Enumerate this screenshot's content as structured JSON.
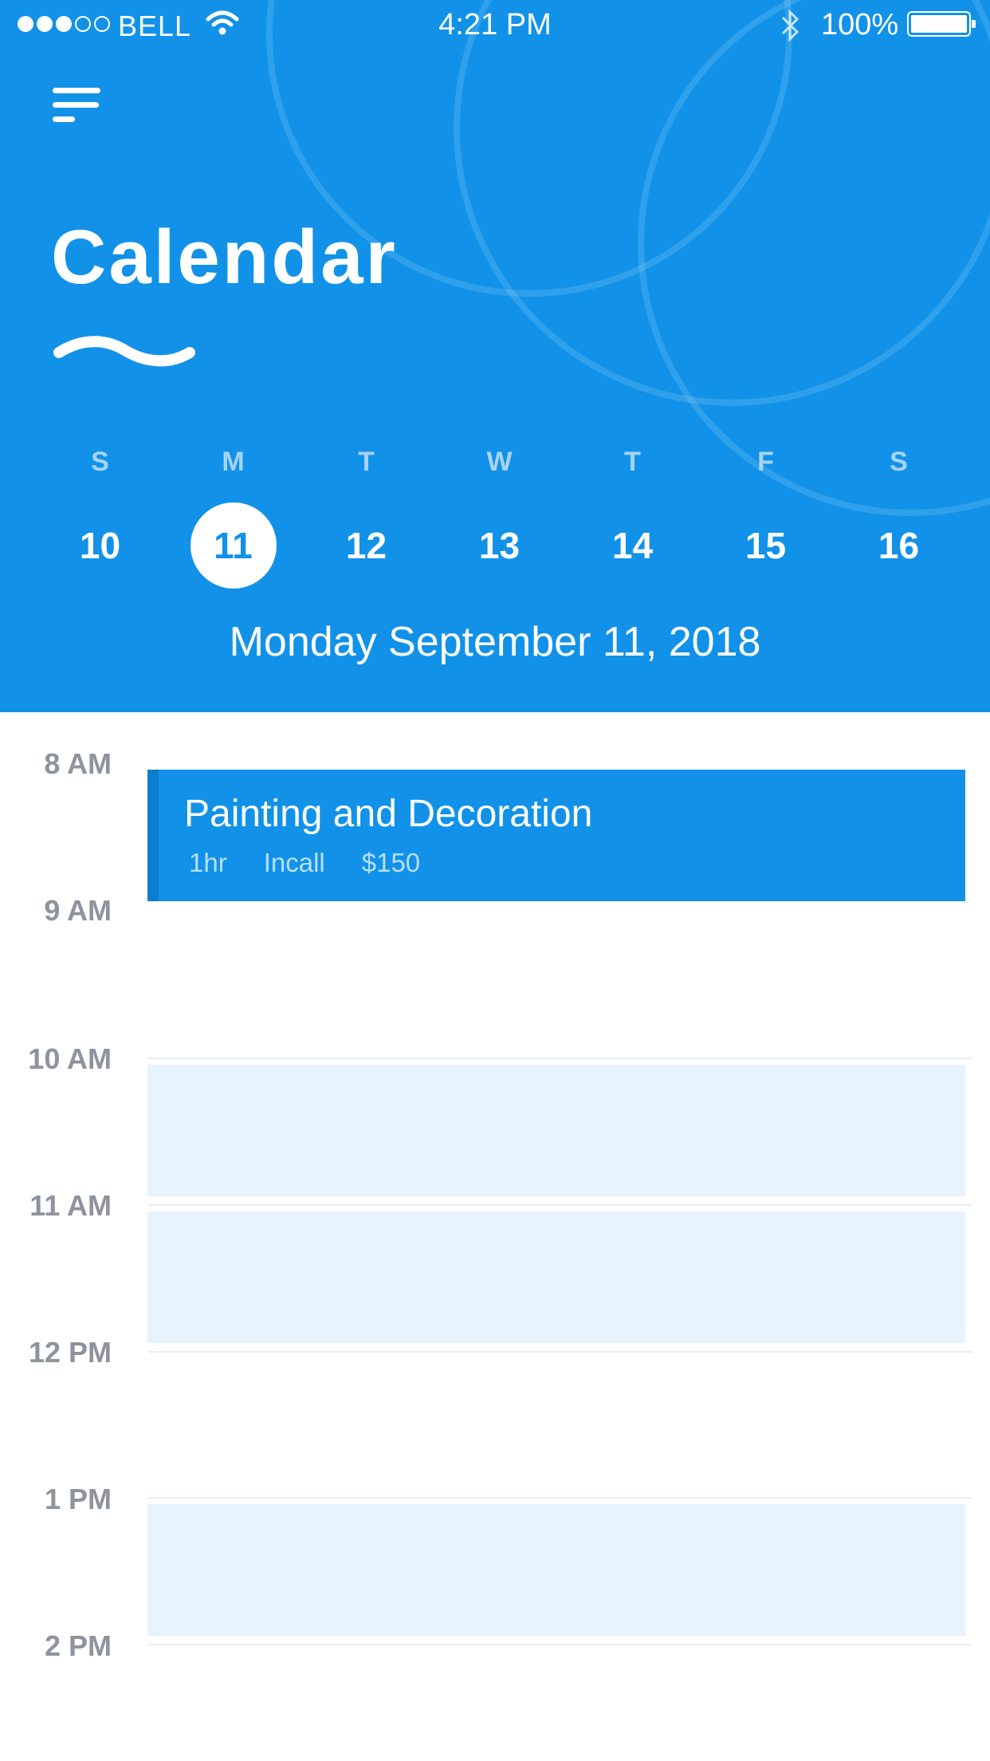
{
  "status_bar": {
    "carrier": "BELL",
    "time": "4:21 PM",
    "battery": "100%",
    "signal_filled": 3,
    "signal_total": 5
  },
  "header": {
    "title": "Calendar",
    "background": "#1192e8",
    "selected_date": "Monday September 11, 2018"
  },
  "week": [
    {
      "letter": "S",
      "day": "10"
    },
    {
      "letter": "M",
      "day": "11",
      "selected": true
    },
    {
      "letter": "T",
      "day": "12"
    },
    {
      "letter": "W",
      "day": "13"
    },
    {
      "letter": "T",
      "day": "14"
    },
    {
      "letter": "F",
      "day": "15"
    },
    {
      "letter": "S",
      "day": "16"
    }
  ],
  "hours": [
    "8 AM",
    "9 AM",
    "10 AM",
    "11 AM",
    "12 PM",
    "1 PM",
    "2 PM"
  ],
  "event": {
    "title": "Painting and Decoration",
    "duration": "1hr",
    "type": "Incall",
    "price": "$150"
  },
  "icons": {
    "menu": "menu-icon",
    "wave": "wave-icon",
    "wifi": "wifi-icon",
    "bluetooth": "bluetooth-icon",
    "battery": "battery-icon"
  }
}
